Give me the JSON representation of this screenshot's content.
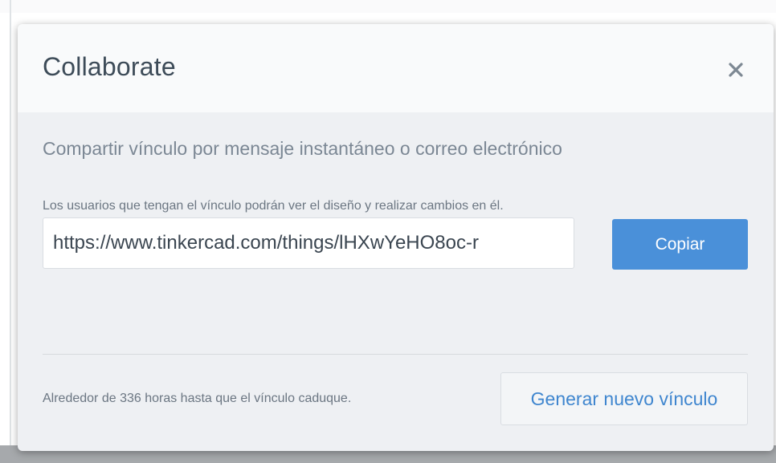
{
  "dialog": {
    "title": "Collaborate",
    "close_icon": "close-icon",
    "share_heading": "Compartir vínculo por mensaje instantáneo o correo electrónico",
    "share_note": "Los usuarios que tengan el vínculo podrán ver el diseño y realizar cambios en él.",
    "link_value": "https://www.tinkercad.com/things/lHXwYeHO8oc-r",
    "copy_label": "Copiar",
    "expiry_text": "Alrededor de 336 horas hasta que el vínculo caduque.",
    "regenerate_label": "Generar nuevo vínculo"
  },
  "colors": {
    "accent": "#4a90d9",
    "link_text": "#3f86cf",
    "title_text": "#3d4b58"
  }
}
